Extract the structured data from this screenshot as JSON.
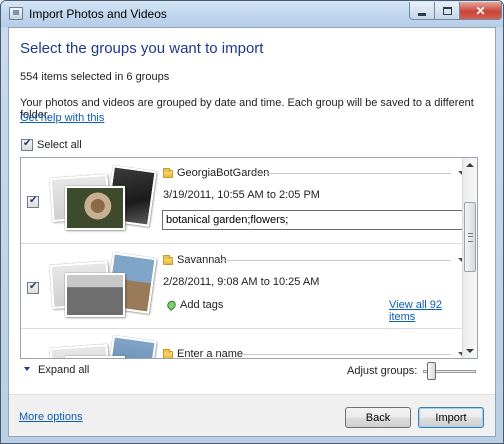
{
  "window": {
    "title": "Import Photos and Videos",
    "close_glyph": "✕"
  },
  "main": {
    "heading": "Select the groups you want to import",
    "count_text": "554 items selected in 6 groups",
    "description": "Your photos and videos are grouped by date and time. Each group will be saved to a different folder.",
    "help_link": "Get help with this",
    "select_all_label": "Select all",
    "select_all_checked": true
  },
  "groups": [
    {
      "name": "GeorgiaBotGarden",
      "date_range": "3/19/2011, 10:55 AM to 2:05 PM",
      "tags": "botanical garden;flowers;",
      "checked": true
    },
    {
      "name": "Savannah",
      "date_range": "2/28/2011, 9:08 AM to 10:25 AM",
      "add_tags_label": "Add tags",
      "view_all_link": "View all 92 items",
      "checked": true
    },
    {
      "name": "Enter a name",
      "checked": false
    }
  ],
  "controls": {
    "expand_all_label": "Expand all",
    "adjust_groups_label": "Adjust groups:",
    "adjust_groups_level": 0.1
  },
  "footer": {
    "more_options": "More options",
    "back_button": "Back",
    "import_button": "Import"
  },
  "icons": {
    "app": "photo-import-icon",
    "folder": "folder-icon",
    "tag": "tag-icon",
    "dropdown": "chevron-down-icon",
    "expand": "triangle-down-icon"
  },
  "colors": {
    "heading": "#1c3a8c",
    "link": "#0d5cb6",
    "titlebar": "#c2d7ee",
    "close_button": "#c7463a"
  }
}
